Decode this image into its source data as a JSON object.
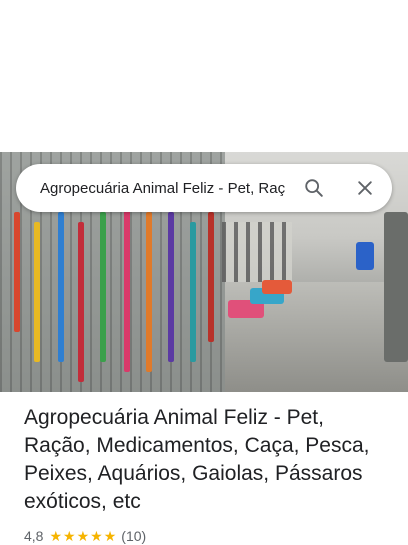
{
  "search": {
    "query": "Agropecuária Animal Feliz - Pet, Raç"
  },
  "place": {
    "title": "Agropecuária Animal Feliz - Pet, Ração, Medicamentos, Caça, Pesca, Peixes, Aquários, Gaiolas, Pássaros exóticos, etc",
    "rating_value": "4,8",
    "stars": 5,
    "review_count": "(10)"
  },
  "colors": {
    "star": "#f6b400",
    "text_primary": "#202124",
    "text_secondary": "#5f6368"
  },
  "icons": {
    "search": "search-icon",
    "close": "close-icon"
  }
}
